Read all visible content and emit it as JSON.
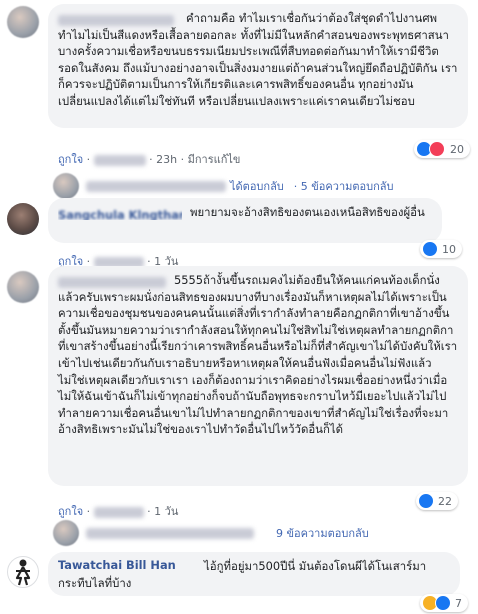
{
  "comments": [
    {
      "text": "คำถามคือ ทำไมเราเชื่อกันว่าต้องใส่ชุดดำไปงานศพ ทำไมไม่เป็นสีแดงหรือเสื้อลายดอกละ ทั้งที่ไม่มีในหลักคำสอนของพระพุทธศาสนา บางครั้งความเชื่อหรือขนบธรรมเนียมประเพณีที่สืบทอดต่อกันมาทำให้เรามีชีวิตรอดในสังคม ถึงแม้บางอย่างอาจเป็นสิ่งงมงายแต่ถ้าคนส่วนใหญ่ยึดถือปฏิบัติกัน เราก็ควรจะปฏิบัติตามเป็นการให้เกียรติและเคารพสิทธิ์ของคนอื่น ทุกอย่างมันเปลี่ยนแปลงได้แต่ไม่ใช่ทันที หรือเปลี่ยนแปลงเพราะแค่เราคนเดียวไม่ชอบ",
      "like": "ถูกใจ",
      "reply": "ตอบกลับ",
      "time": "23h",
      "edited": "มีการแก้ไข",
      "reactions": "20"
    },
    {
      "name": "Sangchula Klngtharatuk",
      "text": "พยายามจะอ้างสิทธิของตนเองเหนือสิทธิของผู้อื่น",
      "like": "ถูกใจ",
      "reply": "ตอบกลับ",
      "time": "1 วัน",
      "reactions": "10"
    },
    {
      "text": "5555ถ้างั้นขึ้นรถเมคงไม่ต้องยืนให้คนแก่คนท้องเด็กนั่งแล้วครับเพราะผมนั่งก่อนสิทธของผมบางทีบางเรื่องมันก็หาเหตุผลไม่ได้เพราะเป็นความเชื่อของชุมชนของคนคนนั้นแต่สิ่งที่เรากำลังทำลายคือกฏกติกาที่เขาอ้างขึ้นตั้งขึ้นมันหมายความว่าเรากำลังสอนให้ทุกคนไม่ใช่สิทไม่ใช่เหตุผลทำลายกฏกติกาที่เขาสร้างขึ้นอย่างนี้เรียกว่าเคารพสิทธิ์คนอื่นหรือไม่ก็ที่สำคัญเขาไม่ได้บังคับให้เราเข้าไปเช่นเดียวกันกับเราอธิบายหรือหาเหตุผลให้คนอื่นฟังเมื่อคนอื่นไม่ฟังแล้วไม่ใช่เหตุผลเดียวกับเราเรา เองก็ต้องถามว่าเราคิดอย่างไรผมเชื่ออย่างหนึ่งว่าเมื่อไม่ให้ฉันเข้าฉันก็ไม่เข้าทุกอย่างก็จบถ้านับถือพุทธจะกราบไหว้มีเยอะไปแล้วไม่ไปทำลายความเชื่อคนอื่นเขาไม่ไปทำลายกฏกติกาของเขาที่สำคัญไม่ใช่เรื่องที่จะมาอ้างสิทธิเพราะมันไม่ใช่ของเราไปทำวัดอื่นไปไหว้วัดอื่นก็ได้",
      "like": "ถูกใจ",
      "reply": "ตอบกลับ",
      "time": "1 วัน",
      "reactions": "22"
    },
    {
      "name": "Tawatchai Bill Han",
      "text": "ไอ้กูที่อยู่มา500ปีนี่ มันต้องโดนผีได้โนเสาร์มากระทืบไลที่บ้าง",
      "reactions": "7"
    }
  ],
  "replies": [
    {
      "reply": "ได้ตอบกลับ",
      "count": "· 5 ข้อความตอบกลับ"
    },
    {
      "count": "9 ข้อความตอบกลับ"
    }
  ],
  "icons": [
    "reply-arrow-icon",
    "like-reaction-icon",
    "love-reaction-icon",
    "haha-reaction-icon"
  ],
  "colors": {
    "link": "#385898",
    "bubble": "#f2f3f5",
    "like": "#1877f2"
  }
}
